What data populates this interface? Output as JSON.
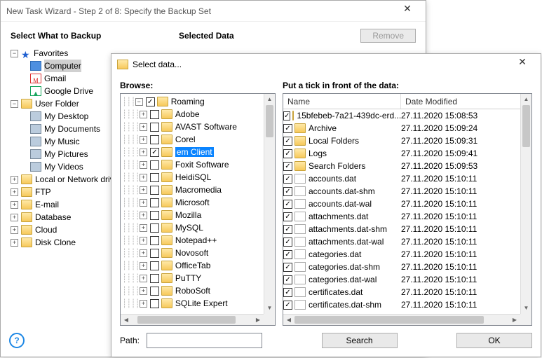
{
  "wizard": {
    "title": "New Task Wizard - Step 2 of 8: Specify the Backup Set",
    "section_left": "Select What to Backup",
    "section_right": "Selected Data",
    "remove_btn": "Remove",
    "tree": {
      "favorites": "Favorites",
      "computer": "Computer",
      "gmail": "Gmail",
      "gdrive": "Google Drive",
      "user_folder": "User Folder",
      "desktop": "My Desktop",
      "documents": "My Documents",
      "music": "My Music",
      "pictures": "My Pictures",
      "videos": "My Videos",
      "network": "Local or Network drive",
      "ftp": "FTP",
      "email": "E-mail",
      "database": "Database",
      "cloud": "Cloud",
      "diskclone": "Disk Clone"
    },
    "help": "?"
  },
  "dialog": {
    "title": "Select data...",
    "browse_label": "Browse:",
    "list_label": "Put a tick in front of the data:",
    "col_name": "Name",
    "col_date": "Date Modified",
    "path_label": "Path:",
    "path_value": "",
    "search_btn": "Search",
    "ok_btn": "OK",
    "browse_root": "Roaming",
    "browse_items": [
      {
        "label": "Adobe",
        "checked": false
      },
      {
        "label": "AVAST Software",
        "checked": false
      },
      {
        "label": "Corel",
        "checked": false
      },
      {
        "label": "em Client",
        "checked": true,
        "selected": true
      },
      {
        "label": "Foxit Software",
        "checked": false
      },
      {
        "label": "HeidiSQL",
        "checked": false
      },
      {
        "label": "Macromedia",
        "checked": false
      },
      {
        "label": "Microsoft",
        "checked": false
      },
      {
        "label": "Mozilla",
        "checked": false
      },
      {
        "label": "MySQL",
        "checked": false
      },
      {
        "label": "Notepad++",
        "checked": false
      },
      {
        "label": "Novosoft",
        "checked": false
      },
      {
        "label": "OfficeTab",
        "checked": false
      },
      {
        "label": "PuTTY",
        "checked": false
      },
      {
        "label": "RoboSoft",
        "checked": false
      },
      {
        "label": "SQLite Expert",
        "checked": false
      }
    ],
    "files": [
      {
        "name": "15bfebeb-7a21-439dc-erd...",
        "date": "27.11.2020 15:08:53",
        "folder": true
      },
      {
        "name": "Archive",
        "date": "27.11.2020 15:09:24",
        "folder": true
      },
      {
        "name": "Local Folders",
        "date": "27.11.2020 15:09:31",
        "folder": true
      },
      {
        "name": "Logs",
        "date": "27.11.2020 15:09:41",
        "folder": true
      },
      {
        "name": "Search Folders",
        "date": "27.11.2020 15:09:53",
        "folder": true
      },
      {
        "name": "accounts.dat",
        "date": "27.11.2020 15:10:11",
        "folder": false
      },
      {
        "name": "accounts.dat-shm",
        "date": "27.11.2020 15:10:11",
        "folder": false
      },
      {
        "name": "accounts.dat-wal",
        "date": "27.11.2020 15:10:11",
        "folder": false
      },
      {
        "name": "attachments.dat",
        "date": "27.11.2020 15:10:11",
        "folder": false
      },
      {
        "name": "attachments.dat-shm",
        "date": "27.11.2020 15:10:11",
        "folder": false
      },
      {
        "name": "attachments.dat-wal",
        "date": "27.11.2020 15:10:11",
        "folder": false
      },
      {
        "name": "categories.dat",
        "date": "27.11.2020 15:10:11",
        "folder": false
      },
      {
        "name": "categories.dat-shm",
        "date": "27.11.2020 15:10:11",
        "folder": false
      },
      {
        "name": "categories.dat-wal",
        "date": "27.11.2020 15:10:11",
        "folder": false
      },
      {
        "name": "certificates.dat",
        "date": "27.11.2020 15:10:11",
        "folder": false
      },
      {
        "name": "certificates.dat-shm",
        "date": "27.11.2020 15:10:11",
        "folder": false
      }
    ]
  }
}
